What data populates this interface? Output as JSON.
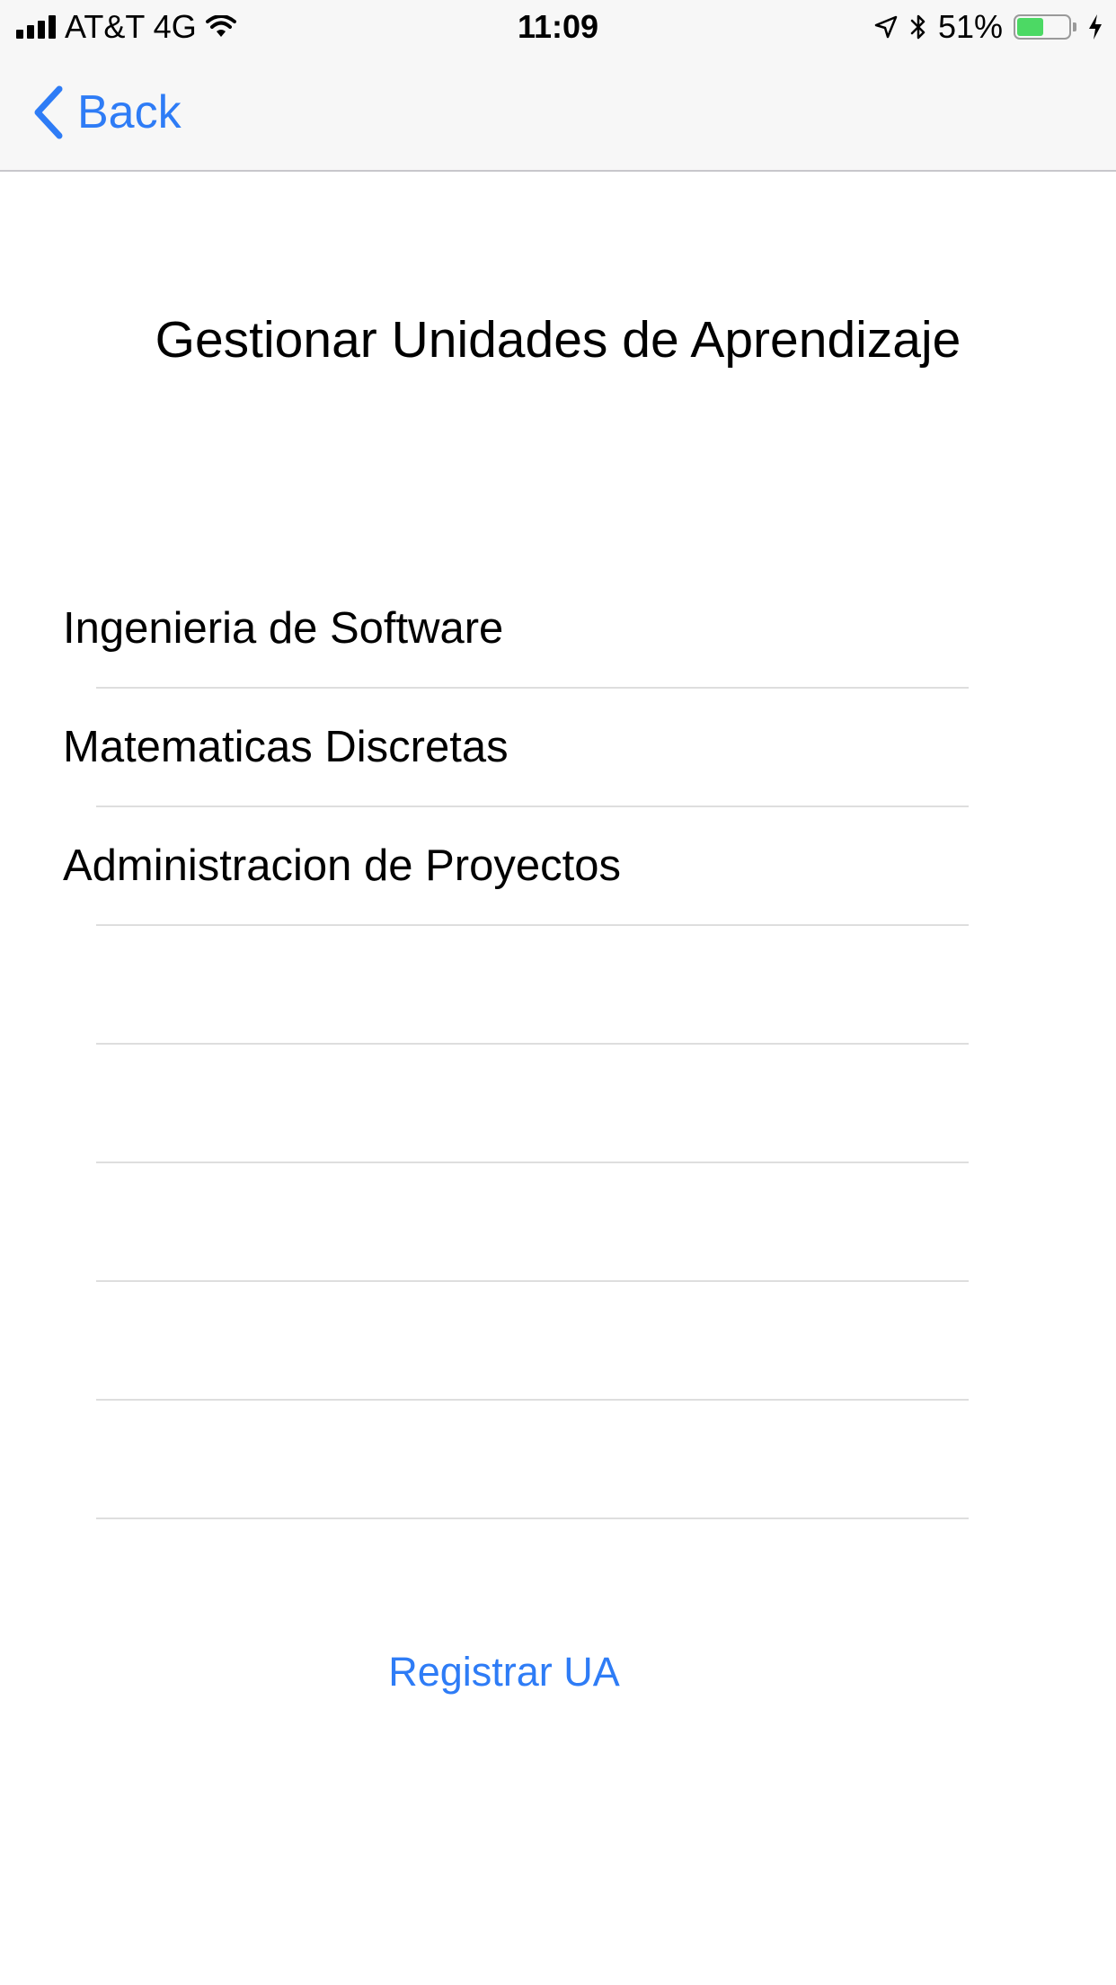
{
  "status_bar": {
    "carrier": "AT&T 4G",
    "time": "11:09",
    "battery_percent": "51%",
    "battery_level": 0.51,
    "battery_color": "#4cd964",
    "icons": [
      "signal-icon",
      "wifi-icon",
      "location-icon",
      "bluetooth-icon",
      "battery-icon",
      "charging-icon"
    ]
  },
  "nav": {
    "back_label": "Back",
    "accent_color": "#2e7cf6"
  },
  "page": {
    "title": "Gestionar Unidades de Aprendizaje"
  },
  "ua_list": {
    "rows": [
      {
        "label": "Ingenieria de Software"
      },
      {
        "label": "Matematicas Discretas"
      },
      {
        "label": "Administracion de Proyectos"
      },
      {
        "label": ""
      },
      {
        "label": ""
      },
      {
        "label": ""
      },
      {
        "label": ""
      },
      {
        "label": ""
      }
    ]
  },
  "actions": {
    "register_label": "Registrar UA"
  }
}
